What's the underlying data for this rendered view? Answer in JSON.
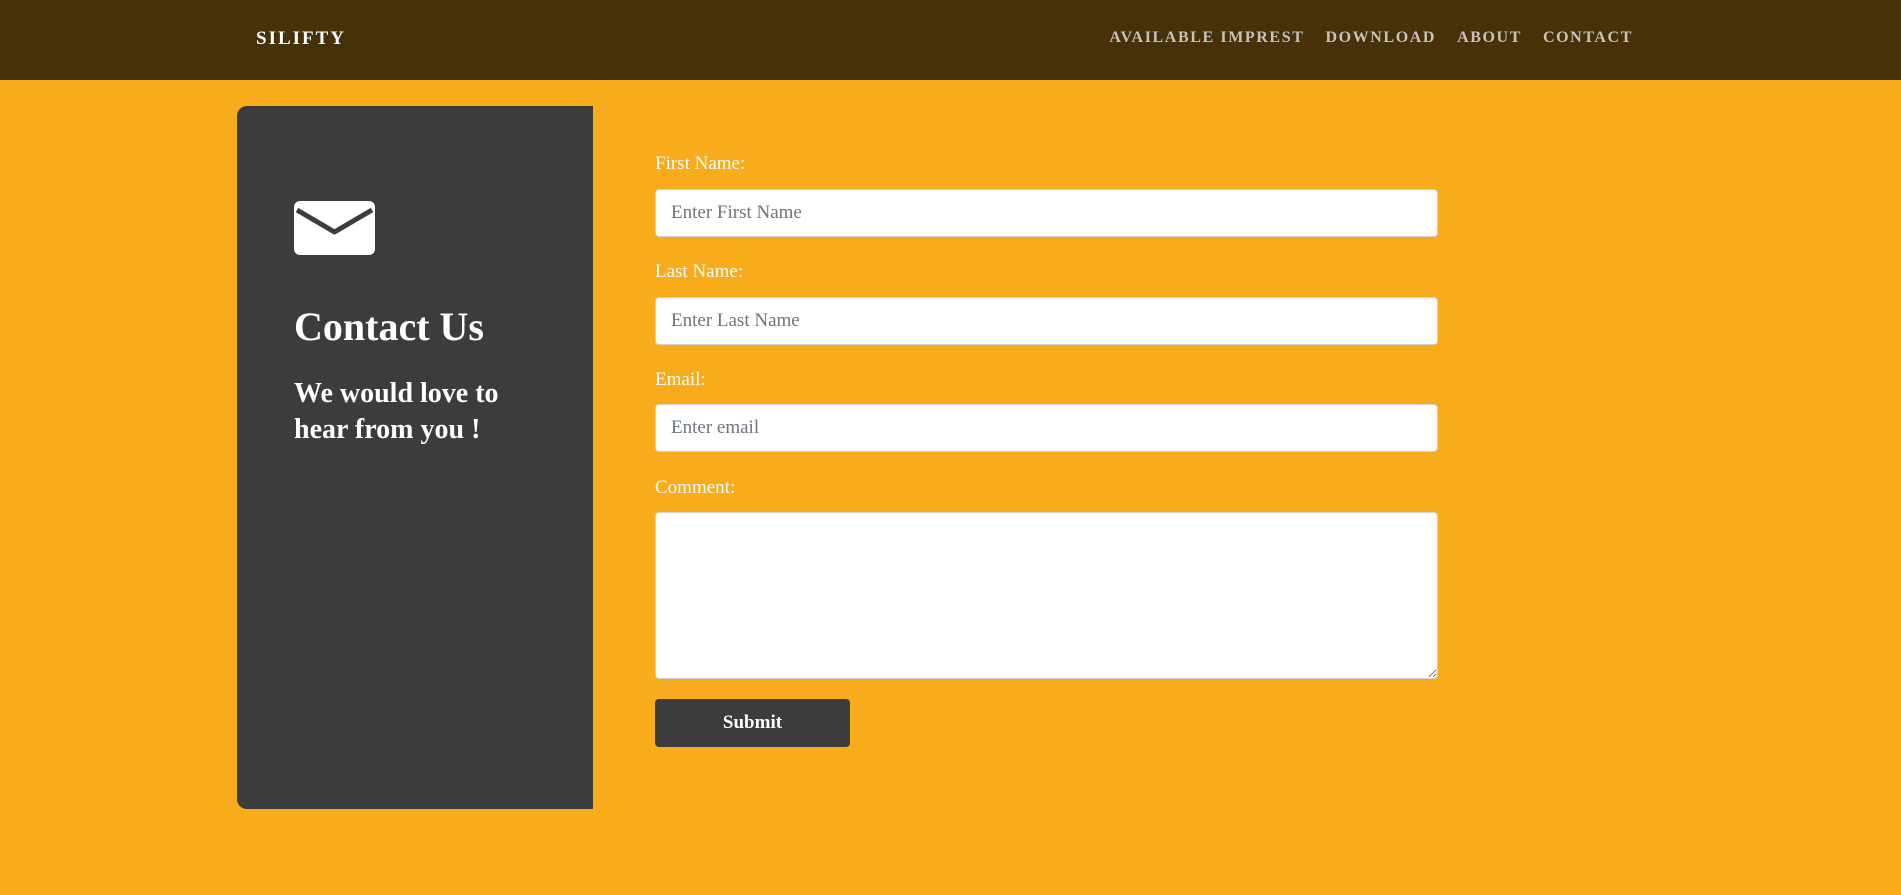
{
  "navbar": {
    "brand": "SILIFTY",
    "links": [
      "AVAILABLE IMPREST",
      "DOWNLOAD",
      "ABOUT",
      "CONTACT"
    ]
  },
  "contact_card": {
    "icon": "envelope-icon",
    "title": "Contact Us",
    "subtitle": "We would love to hear from you !"
  },
  "form": {
    "first_name": {
      "label": "First Name:",
      "placeholder": "Enter First Name",
      "value": ""
    },
    "last_name": {
      "label": "Last Name:",
      "placeholder": "Enter Last Name",
      "value": ""
    },
    "email": {
      "label": "Email:",
      "placeholder": "Enter email",
      "value": ""
    },
    "comment": {
      "label": "Comment:",
      "value": ""
    },
    "submit_label": "Submit"
  },
  "colors": {
    "page_background": "#F9AC1B",
    "navbar_background": "#473108",
    "card_background": "#3C3C3C",
    "button_background": "#3C3C3C",
    "nav_link_text": "#C7C3BB"
  }
}
